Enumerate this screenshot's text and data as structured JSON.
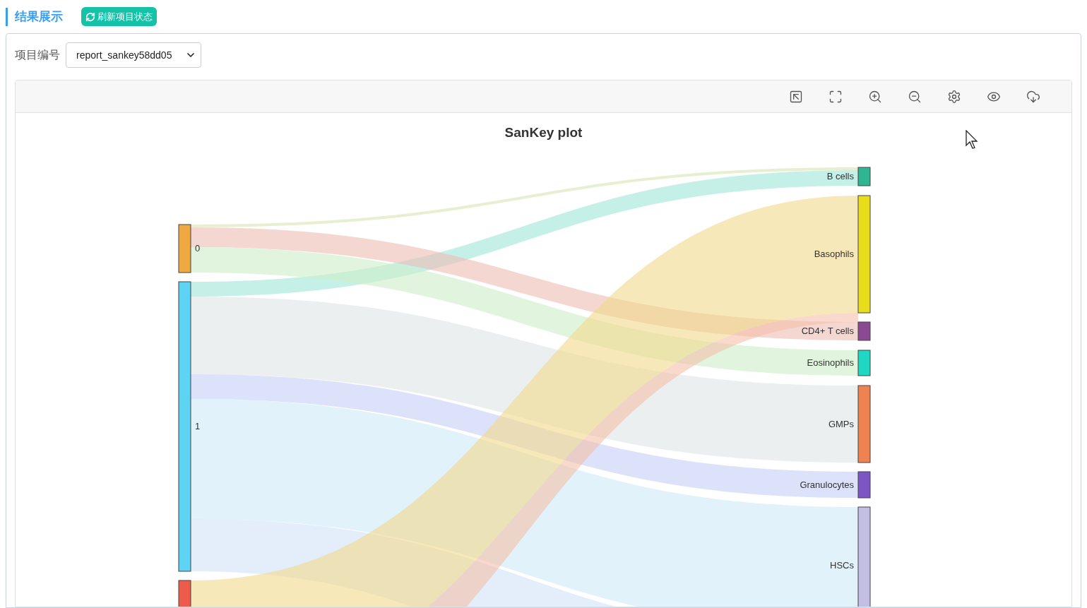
{
  "header": {
    "title": "结果展示",
    "refresh_button": "刷新项目状态"
  },
  "project": {
    "label": "项目编号",
    "value": "report_sankey58dd05"
  },
  "chart": {
    "title": "SanKey plot",
    "source_nodes": [
      {
        "label": "0",
        "color": "#eeaa40"
      },
      {
        "label": "1",
        "color": "#5ed3f3"
      },
      {
        "color": "#ef5b4b"
      }
    ],
    "target_nodes": [
      {
        "label": "B cells",
        "color": "#2fb592"
      },
      {
        "label": "Basophils",
        "color": "#e8dc1c"
      },
      {
        "label": "CD4+ T cells",
        "color": "#8a4a92"
      },
      {
        "label": "Eosinophils",
        "color": "#1fd8c4"
      },
      {
        "label": "GMPs",
        "color": "#ee8250"
      },
      {
        "label": "Granulocytes",
        "color": "#7f55c6"
      },
      {
        "label": "HSCs",
        "color": "#c3bfe2"
      }
    ]
  }
}
